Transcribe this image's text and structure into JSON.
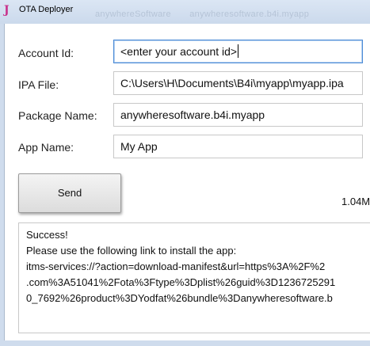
{
  "window": {
    "title": "OTA Deployer",
    "background_titles": [
      "anywhereSoftware",
      "anywheresoftware.b4i.myapp"
    ]
  },
  "form": {
    "account_id": {
      "label": "Account Id:",
      "value": "<enter your account id>"
    },
    "ipa_file": {
      "label": "IPA File:",
      "value": "C:\\Users\\H\\Documents\\B4i\\myapp\\myapp.ipa"
    },
    "package_name": {
      "label": "Package Name:",
      "value": "anywheresoftware.b4i.myapp"
    },
    "app_name": {
      "label": "App Name:",
      "value": "My App"
    }
  },
  "send_button": {
    "label": "Send"
  },
  "file_size": "1.04M",
  "output": {
    "lines": [
      "Success!",
      "Please use the following link to install the app:",
      "itms-services://?action=download-manifest&url=https%3A%2F%2",
      ".com%3A51041%2Fota%3Ftype%3Dplist%26guid%3D1236725291",
      "0_7692%26product%3DYodfat%26bundle%3Danywheresoftware.b"
    ]
  },
  "colors": {
    "accent": "#c8328c",
    "focus_border": "#4a8ad6",
    "frame": "#cfdced"
  },
  "icons": {
    "app": "J-logo-icon"
  }
}
